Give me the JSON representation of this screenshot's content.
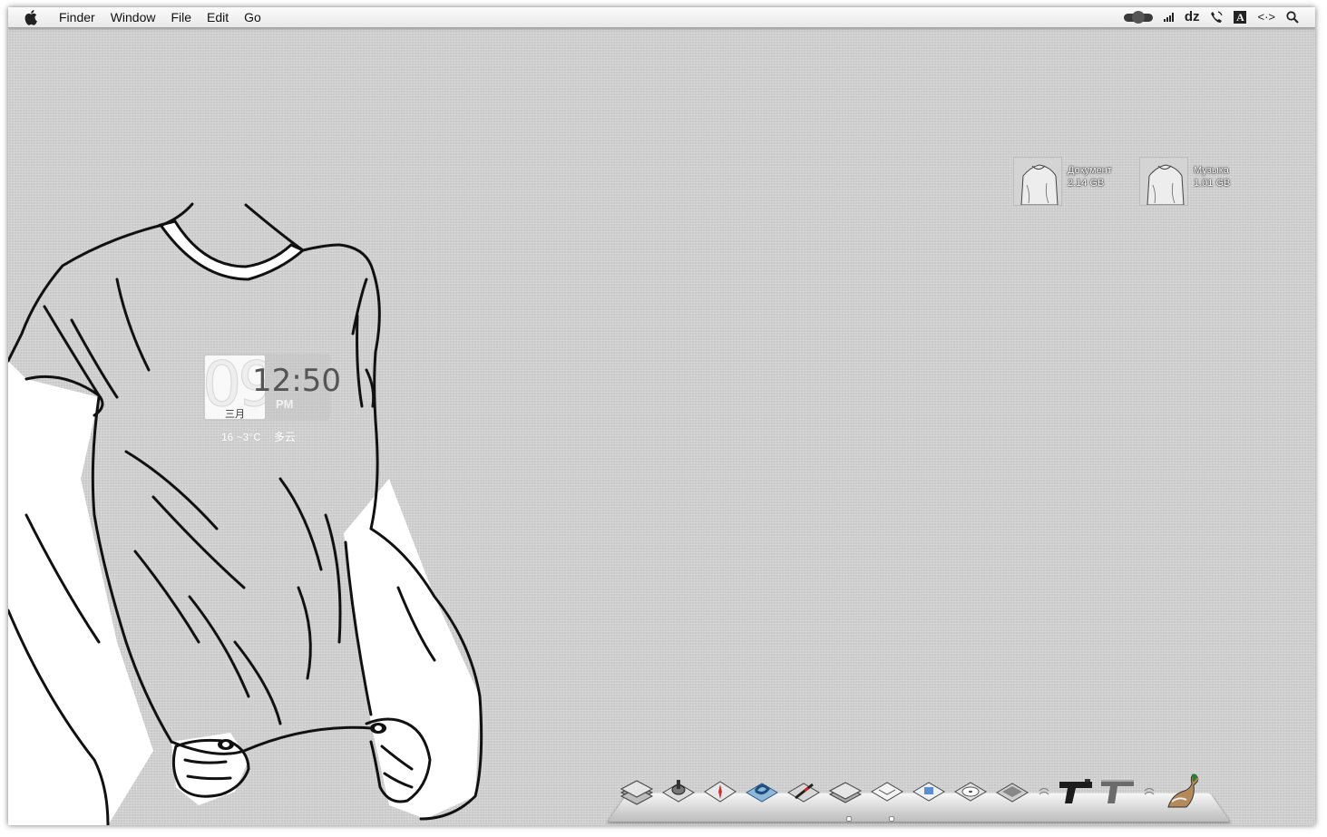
{
  "menubar": {
    "apple_icon": "apple-logo-icon",
    "items": [
      "Finder",
      "Window",
      "File",
      "Edit",
      "Go"
    ],
    "status_icons": [
      "toggle-icon",
      "signal-icon",
      "dz-icon",
      "phone-icon",
      "font-icon",
      "code-brackets-icon",
      "search-icon"
    ],
    "dz_label": "dz",
    "font_label": "A",
    "code_label": "<·>"
  },
  "clock_widget": {
    "day": "09",
    "month": "三月",
    "time": "12:50",
    "ampm": "PM",
    "temperature": "16 ~3°C",
    "condition": "多云"
  },
  "desktop_drives": [
    {
      "name": "Документ",
      "size": "2.14 GB",
      "icon": "drive-icon"
    },
    {
      "name": "Музыка",
      "size": "1.01 GB",
      "icon": "drive-icon"
    }
  ],
  "dock": {
    "items": [
      "stack-icon",
      "disk-utility-icon",
      "compass-icon",
      "blue-link-icon",
      "pen-icon",
      "plain-stack-icon",
      "mail-icon",
      "preview-icon",
      "dvd-icon",
      "drive-icon",
      "separator",
      "pistol-icon",
      "revolver-icon",
      "separator",
      "duck-icon"
    ]
  },
  "colors": {
    "desktop": "#c9c9c9",
    "menubar": "#f0f0f0"
  }
}
